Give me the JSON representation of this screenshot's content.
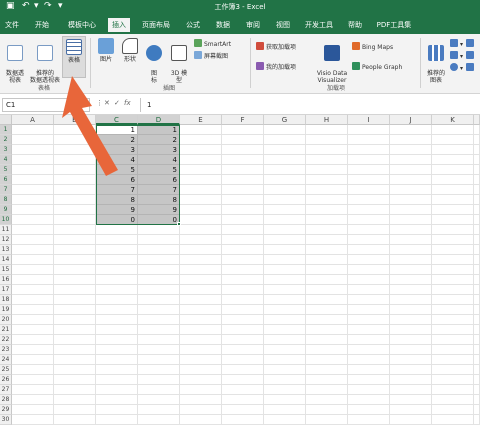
{
  "window": {
    "title": "工作簿3 - Excel"
  },
  "quick_access": {
    "save_icon": "save-icon",
    "undo_icon": "undo-icon",
    "redo_icon": "redo-icon"
  },
  "tabs": [
    "文件",
    "开始",
    "模板中心",
    "插入",
    "页面布局",
    "公式",
    "数据",
    "审阅",
    "视图",
    "开发工具",
    "帮助",
    "PDF工具集"
  ],
  "active_tab": "插入",
  "ribbon": {
    "pivot_table": "数据透\n视表",
    "recommended_pivot": "推荐的\n数据透视表",
    "table": "表格",
    "pictures": "图片",
    "shapes": "形状",
    "icons": "图\n标",
    "models_3d": "3D 模\n型",
    "smartart": "SmartArt",
    "screenshot": "屏幕截图",
    "get_addins": "获取加载项",
    "my_addins": "我的加载项",
    "visio": "Visio Data\nVisualizer",
    "bing_maps": "Bing Maps",
    "people_graph": "People Graph",
    "recommended_charts": "推荐的\n图表",
    "group_tables": "表格",
    "group_illustrations": "插图",
    "group_addins": "加载项"
  },
  "formula_bar": {
    "name_box": "C1",
    "cancel": "✕",
    "enter": "✓",
    "fx": "fx",
    "value": "1"
  },
  "columns": [
    "A",
    "B",
    "C",
    "D",
    "E",
    "F",
    "G",
    "H",
    "I",
    "J",
    "K"
  ],
  "rows": [
    "1",
    "2",
    "3",
    "4",
    "5",
    "6",
    "7",
    "8",
    "9",
    "10",
    "11",
    "12",
    "13",
    "14",
    "15",
    "16",
    "17",
    "18",
    "19",
    "20",
    "21",
    "22",
    "23",
    "24",
    "25",
    "26",
    "27",
    "28",
    "29",
    "30"
  ],
  "cells": {
    "C": [
      "1",
      "2",
      "3",
      "4",
      "5",
      "6",
      "7",
      "8",
      "9",
      "0"
    ],
    "D": [
      "1",
      "2",
      "3",
      "4",
      "5",
      "6",
      "7",
      "8",
      "9",
      "0"
    ]
  },
  "colors": {
    "accent": "#217346",
    "arrow": "#e8663a"
  }
}
